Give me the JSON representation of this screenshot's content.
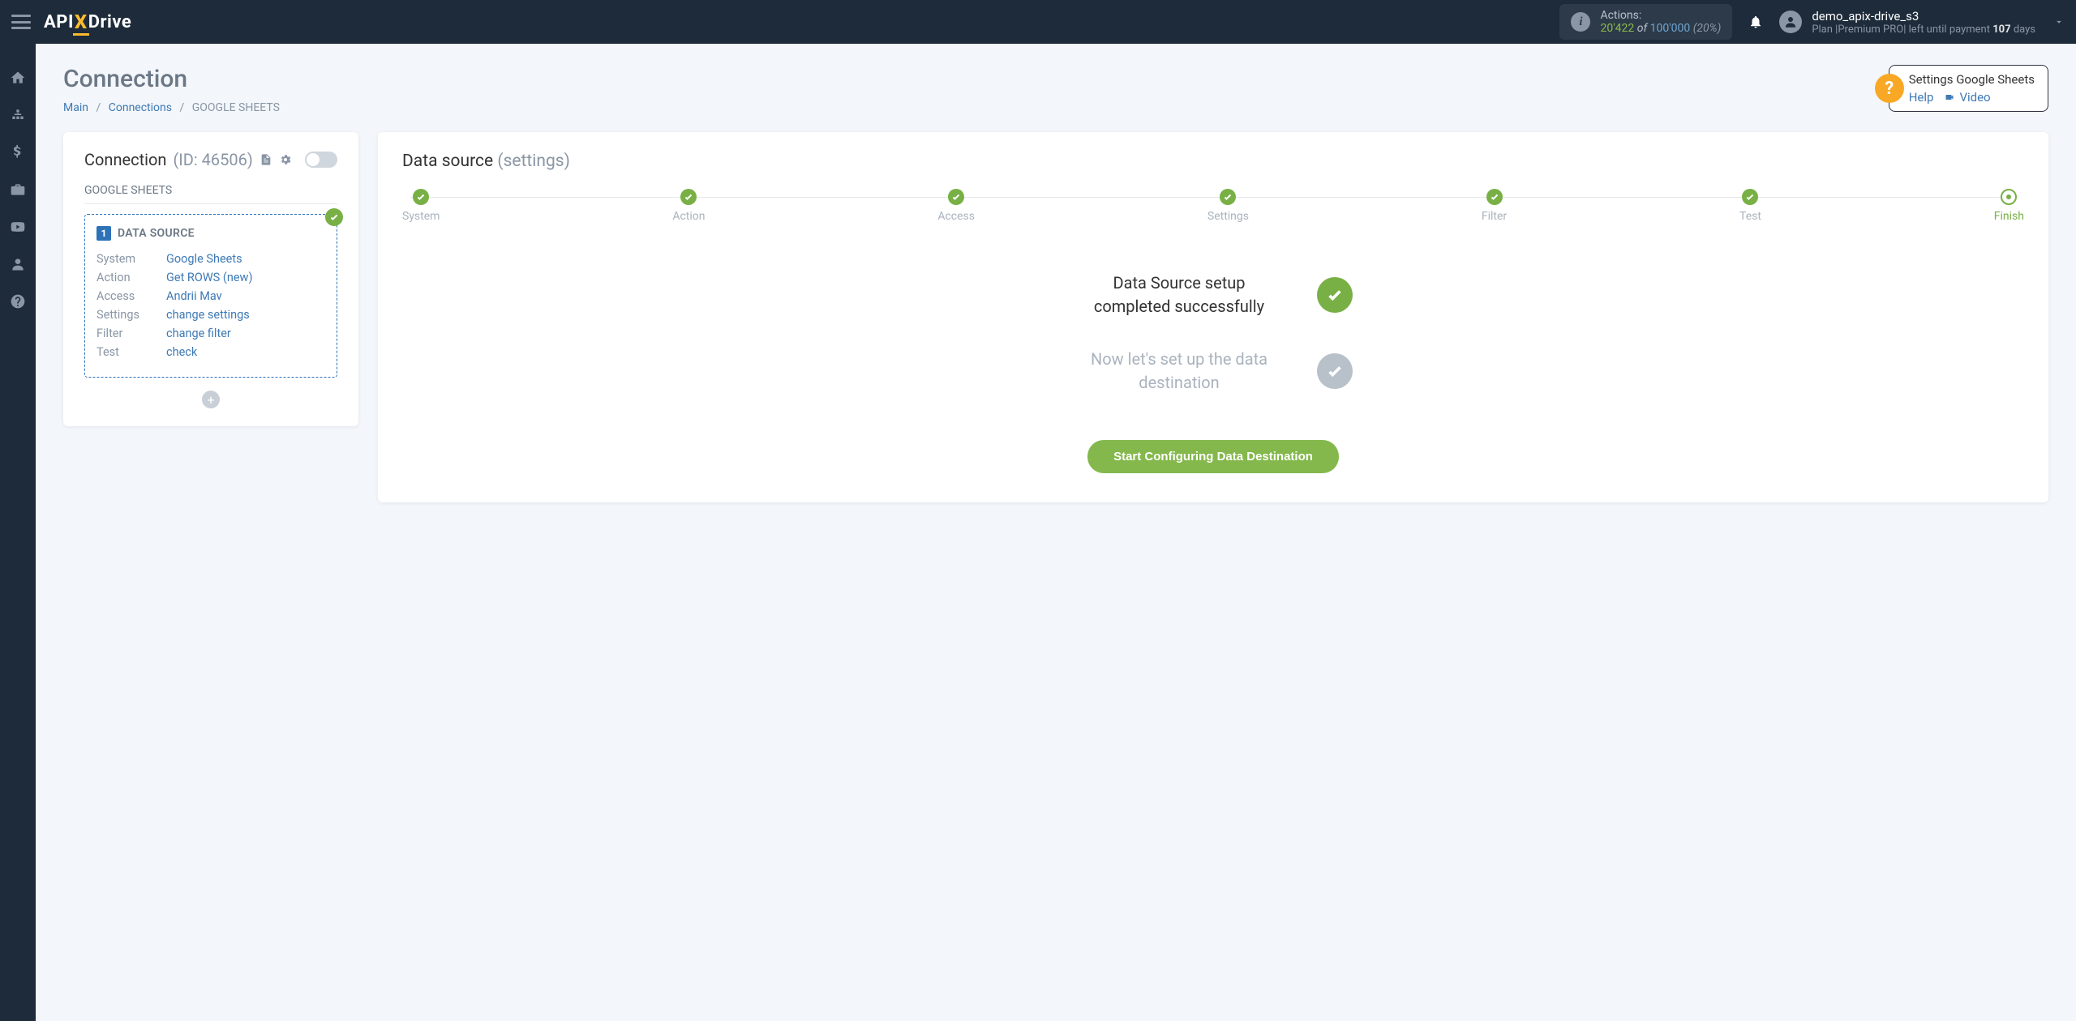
{
  "header": {
    "logo_prefix": "API",
    "logo_x": "X",
    "logo_suffix": "Drive",
    "actions_label": "Actions:",
    "actions_count": "20'422",
    "actions_of": " of ",
    "actions_total": "100'000",
    "actions_pct": " (20%)",
    "user_name": "demo_apix-drive_s3",
    "user_plan_pre": "Plan |",
    "user_plan_name": "Premium PRO",
    "user_plan_mid": "| left until payment ",
    "user_plan_days": "107",
    "user_plan_suf": " days"
  },
  "page": {
    "title": "Connection",
    "breadcrumb": {
      "main": "Main",
      "connections": "Connections",
      "current": "GOOGLE SHEETS"
    }
  },
  "helpbox": {
    "title": "Settings Google Sheets",
    "help": "Help",
    "video": "Video"
  },
  "left": {
    "title": "Connection",
    "id": "(ID: 46506)",
    "sub": "GOOGLE SHEETS",
    "ds_label": "DATA SOURCE",
    "rows": [
      {
        "k": "System",
        "v": "Google Sheets"
      },
      {
        "k": "Action",
        "v": "Get ROWS (new)"
      },
      {
        "k": "Access",
        "v": "Andrii Mav"
      },
      {
        "k": "Settings",
        "v": "change settings"
      },
      {
        "k": "Filter",
        "v": "change filter"
      },
      {
        "k": "Test",
        "v": "check"
      }
    ]
  },
  "right": {
    "title": "Data source",
    "title_sub": "(settings)",
    "steps": [
      "System",
      "Action",
      "Access",
      "Settings",
      "Filter",
      "Test",
      "Finish"
    ],
    "status1": "Data Source setup completed successfully",
    "status2": "Now let's set up the data destination",
    "button": "Start Configuring Data Destination"
  }
}
